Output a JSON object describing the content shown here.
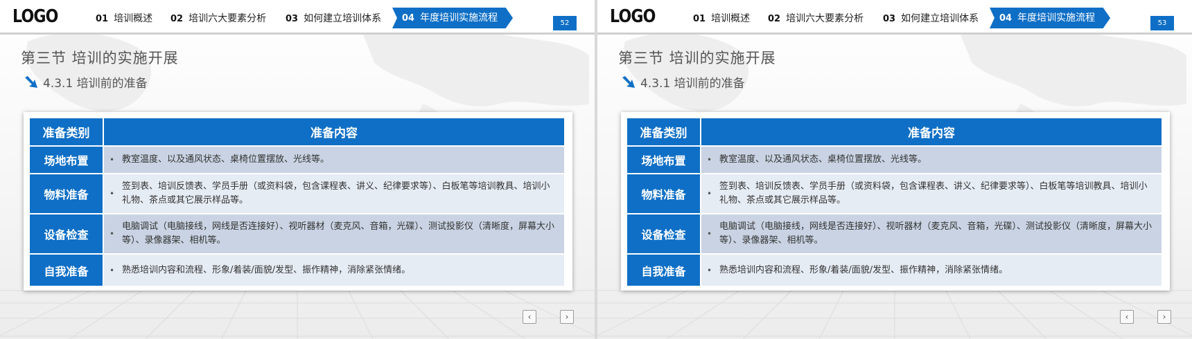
{
  "logo": "LOGO",
  "nav": [
    {
      "num": "01",
      "label": "培训概述"
    },
    {
      "num": "02",
      "label": "培训六大要素分析"
    },
    {
      "num": "03",
      "label": "如何建立培训体系"
    },
    {
      "num": "04",
      "label": "年度培训实施流程"
    }
  ],
  "active_nav_index": 3,
  "section_title": "第三节  培训的实施开展",
  "sub_title": "4.3.1 培训前的准备",
  "table": {
    "headers": [
      "准备类别",
      "准备内容"
    ],
    "rows": [
      {
        "category": "场地布置",
        "content": "教室温度、以及通风状态、桌椅位置摆放、光线等。"
      },
      {
        "category": "物料准备",
        "content": "签到表、培训反馈表、学员手册（或资料袋，包含课程表、讲义、纪律要求等）、白板笔等培训教具、培训小礼物、茶点或其它展示样品等。"
      },
      {
        "category": "设备检查",
        "content": "电脑调试（电脑接线，网线是否连接好）、视听器材（麦克风、音箱，光碟）、测试投影仪（清晰度，屏幕大小等）、录像器架、相机等。"
      },
      {
        "category": "自我准备",
        "content": "熟悉培训内容和流程、形象/着装/面貌/发型、振作精神，消除紧张情绪。"
      }
    ]
  },
  "slides": [
    {
      "page_number": "52"
    },
    {
      "page_number": "53"
    }
  ],
  "controls": {
    "prev": "‹",
    "next": "›"
  },
  "colors": {
    "accent": "#0f6fc6",
    "row_dark": "#c9d3e3",
    "row_light": "#e6ecf4"
  }
}
